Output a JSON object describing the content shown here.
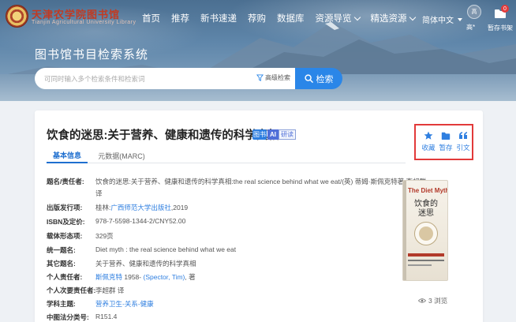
{
  "header": {
    "school_name": "天津农学院图书馆",
    "school_sub": "Tianjin Agricultural University Library",
    "nav": [
      {
        "label": "首页"
      },
      {
        "label": "推荐"
      },
      {
        "label": "新书速递"
      },
      {
        "label": "荐购"
      },
      {
        "label": "数据库"
      },
      {
        "label": "资源导览",
        "dropdown": true
      },
      {
        "label": "精选资源",
        "dropdown": true
      }
    ],
    "language": "简体中文",
    "avatar_text": "高",
    "user_name": "高*",
    "shelf_label": "暂存书架",
    "shelf_count": "0"
  },
  "hero": {
    "system_title": "图书馆书目检索系统",
    "search_placeholder": "可同时输入多个检索条件和检索词",
    "advanced_search": "高级检索",
    "search_button": "检索"
  },
  "record": {
    "title": "饮食的迷思:关于营养、健康和遗传的科学真相",
    "badge_book": "图书",
    "badge_ai": "AI",
    "badge_read": "研读",
    "tabs": [
      "基本信息",
      "元数据(MARC)"
    ],
    "actions": [
      "收藏",
      "暂存",
      "引文"
    ],
    "fields": [
      {
        "key": "题名/责任者:",
        "value": "饮食的迷思:关于营养、健康和遗传的科学真相:the real science behind what we eat/(英) 蒂姆·斯佩克特著 李超群",
        "value2": "译"
      },
      {
        "key": "出版发行项:",
        "prefix": "桂林:",
        "link": "广西师范大学出版社",
        "suffix": ",2019"
      },
      {
        "key": "ISBN及定价:",
        "value": "978-7-5598-1344-2/CNY52.00"
      },
      {
        "key": "载体形态项:",
        "value": "329页"
      },
      {
        "key": "统一题名:",
        "value": "Diet myth : the real science behind what we eat"
      },
      {
        "key": "其它题名:",
        "value": "关于营养、健康和遗传的科学真相"
      },
      {
        "key": "个人责任者:",
        "link": "斯佩克特",
        "middle": " 1958- ",
        "link2": "(Spector, Tim)",
        "suffix": ", 著"
      },
      {
        "key": "个人次要责任者:",
        "value": "李超群 译"
      },
      {
        "key": "学科主题:",
        "link": "营养卫生-关系-健康"
      },
      {
        "key": "中图法分类号:",
        "value": "R151.4"
      }
    ],
    "cover": {
      "en_title": "The Diet Myth",
      "cn_title": "饮食的迷思"
    },
    "views": "3 浏览"
  },
  "colors": {
    "accent": "#2a86e8",
    "link": "#2f7fe0",
    "highlight_border": "#e23a3a",
    "logo_red": "#c13a22"
  }
}
